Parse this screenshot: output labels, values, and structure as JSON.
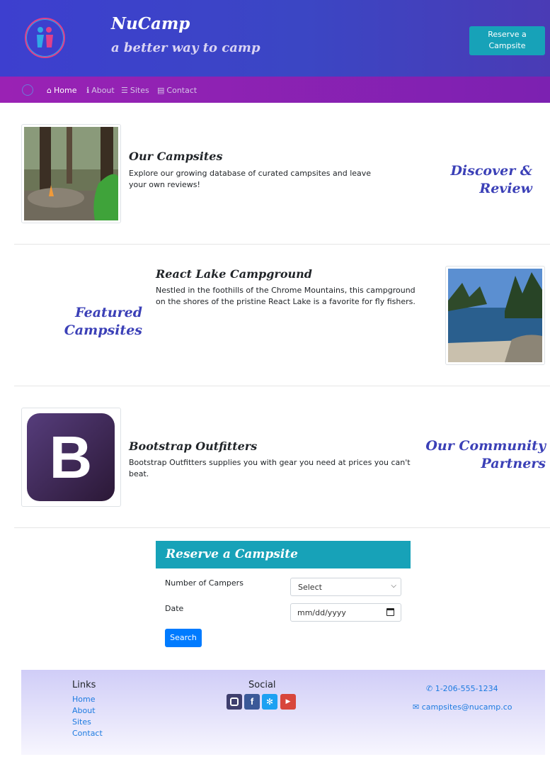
{
  "header": {
    "brand_title": "NuCamp",
    "brand_subtitle": "a better way to camp",
    "reserve_button": "Reserve a Campsite"
  },
  "nav": {
    "items": [
      {
        "label": "Home",
        "icon": "home-icon",
        "active": true
      },
      {
        "label": "About",
        "icon": "info-icon",
        "active": false
      },
      {
        "label": "Sites",
        "icon": "list-icon",
        "active": false
      },
      {
        "label": "Contact",
        "icon": "address-card-icon",
        "active": false
      }
    ]
  },
  "sections": [
    {
      "title": "Our Campsites",
      "text": "Explore our growing database of curated campsites and leave your own reviews!",
      "side_title": "Discover & Review"
    },
    {
      "title": "React Lake Campground",
      "text": "Nestled in the foothills of the Chrome Mountains, this campground on the shores of the pristine React Lake is a favorite for fly fishers.",
      "side_title": "Featured Campsites"
    },
    {
      "title": "Bootstrap Outfitters",
      "text": "Bootstrap Outfitters supplies you with gear you need at prices you can't beat.",
      "side_title": "Our Community Partners",
      "logo_letter": "B"
    }
  ],
  "reserve_form": {
    "heading": "Reserve a Campsite",
    "campers_label": "Number of Campers",
    "campers_value": "Select",
    "date_label": "Date",
    "date_placeholder": "mm/dd/yyyy",
    "search_button": "Search"
  },
  "footer": {
    "links_heading": "Links",
    "links": [
      "Home",
      "About",
      "Sites",
      "Contact"
    ],
    "social_heading": "Social",
    "social": [
      "instagram-icon",
      "facebook-icon",
      "twitter-icon",
      "youtube-icon"
    ],
    "phone": "1-206-555-1234",
    "email": "campsites@nucamp.co"
  },
  "colors": {
    "header_gradient_start": "#3d3fcf",
    "nav_purple": "#9a22b4",
    "teal": "#17a2b8",
    "accent_blue": "#3b40b7",
    "link_blue": "#1d7be0",
    "primary_button": "#007bff"
  }
}
